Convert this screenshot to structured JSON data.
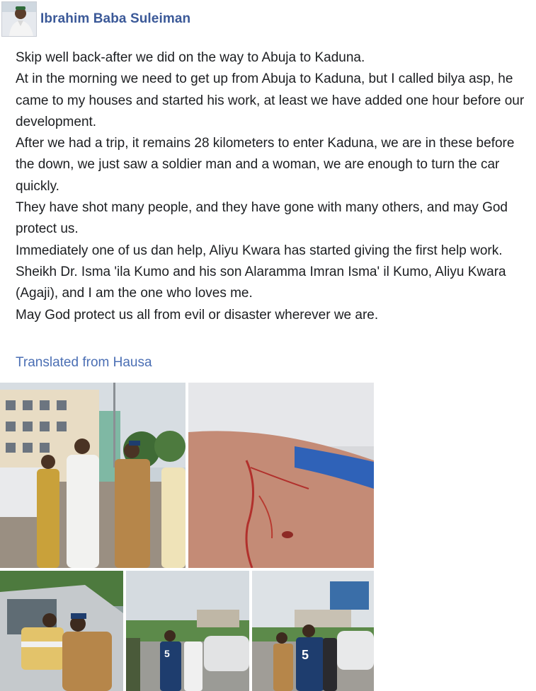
{
  "post": {
    "author": "Ibrahim Baba Suleiman",
    "avatar_icon": "profile-photo",
    "paragraphs": [
      "Skip well back-after we did on the way to Abuja to Kaduna.",
      "At in the morning we need to get up from Abuja to Kaduna, but I called bilya asp, he came to my houses and started his work, at least we have added one hour before our development.",
      "After we had a trip, it remains 28 kilometers to enter Kaduna, we are in these before the down, we just saw a soldier man and a woman, we are enough to turn the car quickly.",
      "They have shot many people, and they have gone with many others, and may God protect us.",
      "Immediately one of us dan help, Aliyu Kwara has started giving the first help work.",
      "Sheikh Dr.  Isma 'ila Kumo and his son Alaramma Imran Isma' il Kumo, Aliyu Kwara (Agaji),  and I am the one who loves me.",
      "May God protect us all from evil or disaster wherever we are."
    ],
    "translate_link": "Translated from Hausa"
  },
  "photos": [
    {
      "name": "group-photo"
    },
    {
      "name": "wound-photo"
    },
    {
      "name": "car-rescue-photo"
    },
    {
      "name": "roadside-photo"
    },
    {
      "name": "carrying-photo"
    }
  ],
  "colors": {
    "author_link": "#3b5998",
    "translate_link": "#4b6fb4",
    "body_text": "#1c1e21"
  }
}
